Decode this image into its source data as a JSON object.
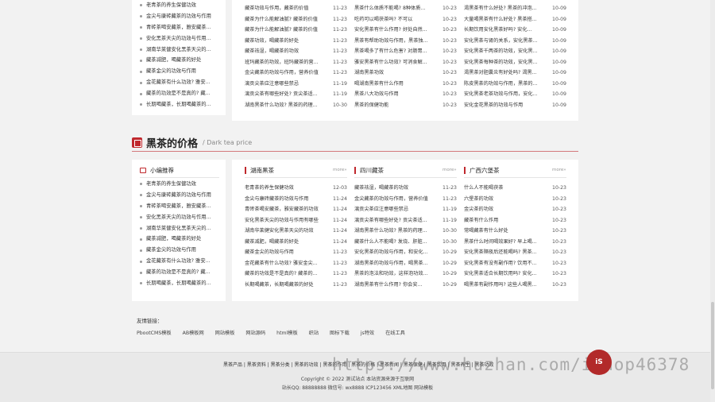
{
  "top_sidebar": [
    "老青茶的养生保健功效",
    "金尖与康砖藏茶的功效与作用",
    "青砖茶喝安藏茶，雅安藏茶...",
    "安化黑茶天尖的功效与作用...",
    "湖南华莱健安化黑茶天尖的...",
    "藏茶减肥，喝藏茶的好处",
    "藏茶金尖的功效与作用",
    "金花藏茶有什么功效? 雅安...",
    "藏茶的功效是不是真的? 藏...",
    "长期喝藏茶，长期喝藏茶的..."
  ],
  "top_columns": [
    [
      [
        "藏茶功效与作用，藏茶的价值",
        "11-23"
      ],
      [
        "藏茶为什么能解油腻? 藏茶的价值",
        "11-23"
      ],
      [
        "藏茶为什么能解油腻? 藏茶的价值",
        "11-23"
      ],
      [
        "藏茶功效，喝藏茶的好处",
        "11-23"
      ],
      [
        "藏茶祛湿，喝藏茶的功效",
        "11-23"
      ],
      [
        "班玛藏茶的功效，班玛藏茶的营...",
        "11-23"
      ],
      [
        "金尖藏茶的功效与作用，营养价值",
        "11-23"
      ],
      [
        "漓贡尖茶应注意哪些禁忌",
        "11-19"
      ],
      [
        "漓贡尖茶有哪些好处? 贡尖茶适...",
        "11-19"
      ],
      [
        "湖南黑茶什么功效? 黑茶的药理...",
        "10-30"
      ]
    ],
    [
      [
        "黑茶什么体质不能喝? 8种体质...",
        "10-23"
      ],
      [
        "吃药可以喝茯茶吗? 不可以",
        "10-23"
      ],
      [
        "安化黑茶有什么作用? 好处自然...",
        "10-23"
      ],
      [
        "黑茶有帮助功效与作用，黑茶独...",
        "10-23"
      ],
      [
        "黑茶喝多了有什么危害? 对肠胃...",
        "10-23"
      ],
      [
        "雅安黑茶有什么功效? 可消食解...",
        "10-23"
      ],
      [
        "湖南黑茶功效",
        "10-23"
      ],
      [
        "喝湖南黑茶有什么作用",
        "10-23"
      ],
      [
        "黑茶八大功效与作用",
        "10-23"
      ],
      [
        "黑茶的保健功能",
        "10-23"
      ]
    ],
    [
      [
        "渴黑茶有什么好处? 黑茶的冲泡...",
        "10-09"
      ],
      [
        "大量喝黑茶有什么好处? 黑茶搭...",
        "10-09"
      ],
      [
        "长期饮用安化黑茶好吗? 安化...",
        "10-09"
      ],
      [
        "安化黑茶与肾的关系，安化黑茶...",
        "10-09"
      ],
      [
        "安化黑茶千两茶的功效，安化黑...",
        "10-09"
      ],
      [
        "安化黑茶每种茶的功效，安化黑...",
        "10-09"
      ],
      [
        "渴黑茶对胆囊炎有好处吗? 渴黑...",
        "10-09"
      ],
      [
        "陈皮黑茶的功效与作用，黑茶的...",
        "10-09"
      ],
      [
        "安化黑茶老茶功效与作用，安化...",
        "10-09"
      ],
      [
        "安化金花黑茶的功效与作用",
        "10-09"
      ]
    ]
  ],
  "section": {
    "title": "黑茶的价格",
    "subtitle": "/ Dark tea price"
  },
  "left_box": {
    "title": "小编推荐",
    "items": [
      "老青茶的养生保健功效",
      "金尖与康砖藏茶的功效与作用",
      "青砖茶喝安藏茶，雅安藏茶...",
      "安化黑茶天尖的功效与作用...",
      "湖南华莱健安化黑茶天尖的...",
      "藏茶减肥，喝藏茶的好处",
      "藏茶金尖的功效与作用",
      "金花藏茶有什么功效? 雅安...",
      "藏茶的功效是不是真的? 藏...",
      "长期喝藏茶，长期喝藏茶的..."
    ]
  },
  "price_columns": [
    {
      "title": "湖南黑茶",
      "more": "more»",
      "rows": [
        [
          "老青茶的养生保健功效",
          "12-03"
        ],
        [
          "金尖与康砖藏茶的功效与作用",
          "11-24"
        ],
        [
          "青砖茶喝安藏茶，雅安藏茶的功效",
          "11-24"
        ],
        [
          "安化黑茶天尖的功效与作用有哪些",
          "11-24"
        ],
        [
          "湖南华莱健安化黑茶天尖的功效",
          "11-24"
        ],
        [
          "藏茶减肥，喝藏茶的好处",
          "11-24"
        ],
        [
          "藏茶金尖的功效与作用",
          "11-23"
        ],
        [
          "金花藏茶有什么功效? 雅安金尖...",
          "11-23"
        ],
        [
          "藏茶的功效是不是真的? 藏茶的...",
          "11-23"
        ],
        [
          "长期喝藏茶，长期喝藏茶的好处",
          "11-23"
        ]
      ]
    },
    {
      "title": "四川藏茶",
      "more": "more»",
      "rows": [
        [
          "藏茶祛湿，喝藏茶的功效",
          "11-23"
        ],
        [
          "金尖藏茶的功效与作用，营养价值",
          "11-23"
        ],
        [
          "漓贡尖茶应注意哪些禁忌",
          "11-19"
        ],
        [
          "漓贡尖茶有哪些好处? 贡尖茶适...",
          "11-19"
        ],
        [
          "湖南黑茶什么功效? 黑茶的药理...",
          "10-30"
        ],
        [
          "藏茶什么人不能喝? 发烧、肝脏...",
          "10-30"
        ],
        [
          "安化黑茶的功效与作用，和安化...",
          "10-29"
        ],
        [
          "湖南黑茶的功效与作用，喝黑茶...",
          "10-29"
        ],
        [
          "黑茶的泡法和功效，这样泡功效...",
          "10-29"
        ],
        [
          "湖南黑茶有什么作用? 你会安...",
          "10-29"
        ]
      ]
    },
    {
      "title": "广西六堡茶",
      "more": "more»",
      "rows": [
        [
          "什么人不能喝茯茶",
          "10-23"
        ],
        [
          "六堡茶的功效",
          "10-23"
        ],
        [
          "金尖茶的功效",
          "10-23"
        ],
        [
          "藏茶有什么作用",
          "10-23"
        ],
        [
          "常喝藏茶有什么好处",
          "10-23"
        ],
        [
          "黑茶什么时间喝效果好? 早上喝...",
          "10-23"
        ],
        [
          "安化黑茶隔夜后还能喝吗? 黑茶...",
          "10-23"
        ],
        [
          "安化黑茶有没有副作用? 饮用不...",
          "10-23"
        ],
        [
          "安化黑茶适合长期饮用吗? 安化...",
          "10-23"
        ],
        [
          "喝黑茶有副作用吗? 这些人喝黑...",
          "10-23"
        ]
      ]
    }
  ],
  "friend_links": {
    "title": "友情链接：",
    "items": [
      "PbootCMS模板",
      "AB模板网",
      "网站模板",
      "网站源码",
      "html模板",
      "织站",
      "图标下载",
      "js特效",
      "在线工具"
    ]
  },
  "footer": {
    "nav": "黑茶产品 | 黑茶资料 | 黑茶分类 | 黑茶的功效 | 黑茶的作用 | 黑茶的价格 | 黑茶新闻 | 黑茶保健 | 黑茶饮用 | 黑茶养生 | 黑茶功效",
    "copyright": "Copyright © 2022 测试站点 本站资源来源于互联网",
    "contact": "站长QQ: 88888888 微信号: wx8888 ICP123456 XML地图 网站模板"
  },
  "watermark": "https://www.huzhan.com/ishop46378",
  "watermark_logo": "iS"
}
